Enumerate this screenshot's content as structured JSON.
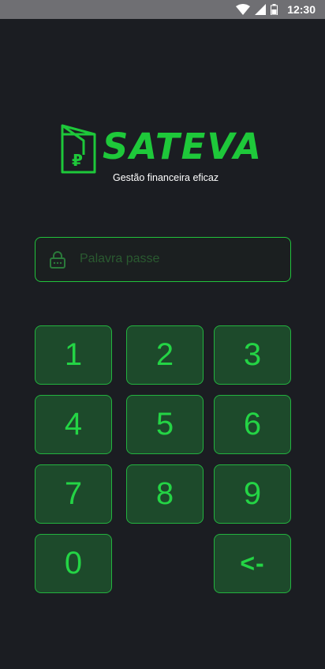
{
  "status_bar": {
    "time": "12:30",
    "icons": [
      "wifi-icon",
      "signal-icon",
      "battery-icon"
    ]
  },
  "brand": {
    "name": "SATEVA",
    "tagline": "Gestão financeira eficaz",
    "logo_icon": "wallet-ruble-icon",
    "color": "#1ec83a"
  },
  "password": {
    "placeholder": "Palavra passe",
    "value": "",
    "icon": "lock-icon"
  },
  "keypad": {
    "k1": "1",
    "k2": "2",
    "k3": "3",
    "k4": "4",
    "k5": "5",
    "k6": "6",
    "k7": "7",
    "k8": "8",
    "k9": "9",
    "k0": "0",
    "backspace": "<-"
  },
  "colors": {
    "background": "#1b1d22",
    "accent": "#21c23c",
    "key_fill": "#1d4a2b"
  }
}
